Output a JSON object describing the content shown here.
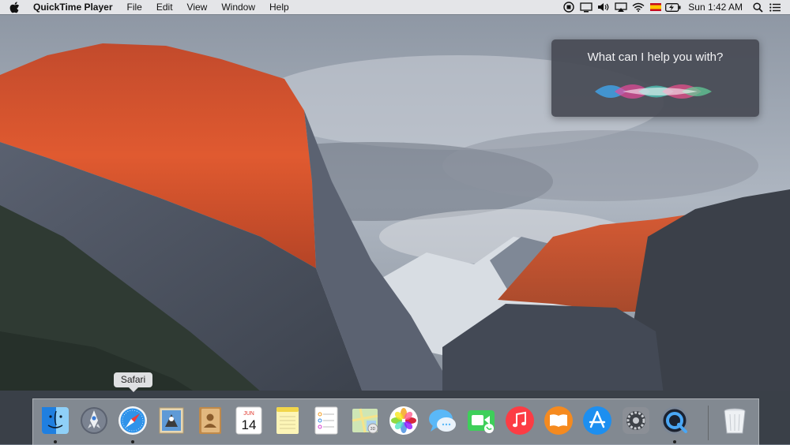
{
  "menubar": {
    "app_name": "QuickTime Player",
    "menus": [
      "File",
      "Edit",
      "View",
      "Window",
      "Help"
    ],
    "clock": "Sun 1:42 AM",
    "status_icons": [
      "record-icon",
      "display-icon",
      "volume-icon",
      "airplay-icon",
      "wifi-icon",
      "flag-icon",
      "battery-icon",
      "search-icon",
      "notification-center-icon"
    ]
  },
  "siri": {
    "prompt": "What can I help you with?"
  },
  "tooltip": {
    "label": "Safari"
  },
  "calendar": {
    "month": "JUN",
    "day": "14"
  },
  "dock": {
    "apps": [
      "Finder",
      "Launchpad",
      "Safari",
      "Mail",
      "Contacts",
      "Calendar",
      "Notes",
      "Reminders",
      "Maps",
      "Photos",
      "Messages",
      "FaceTime",
      "iTunes",
      "iBooks",
      "App Store",
      "System Preferences",
      "QuickTime Player",
      "Trash"
    ],
    "running": [
      "Finder",
      "Safari",
      "QuickTime Player"
    ]
  },
  "colors": {
    "menubar": "#ececee",
    "siri_panel": "#464a54",
    "dock": "#bec4cd"
  }
}
